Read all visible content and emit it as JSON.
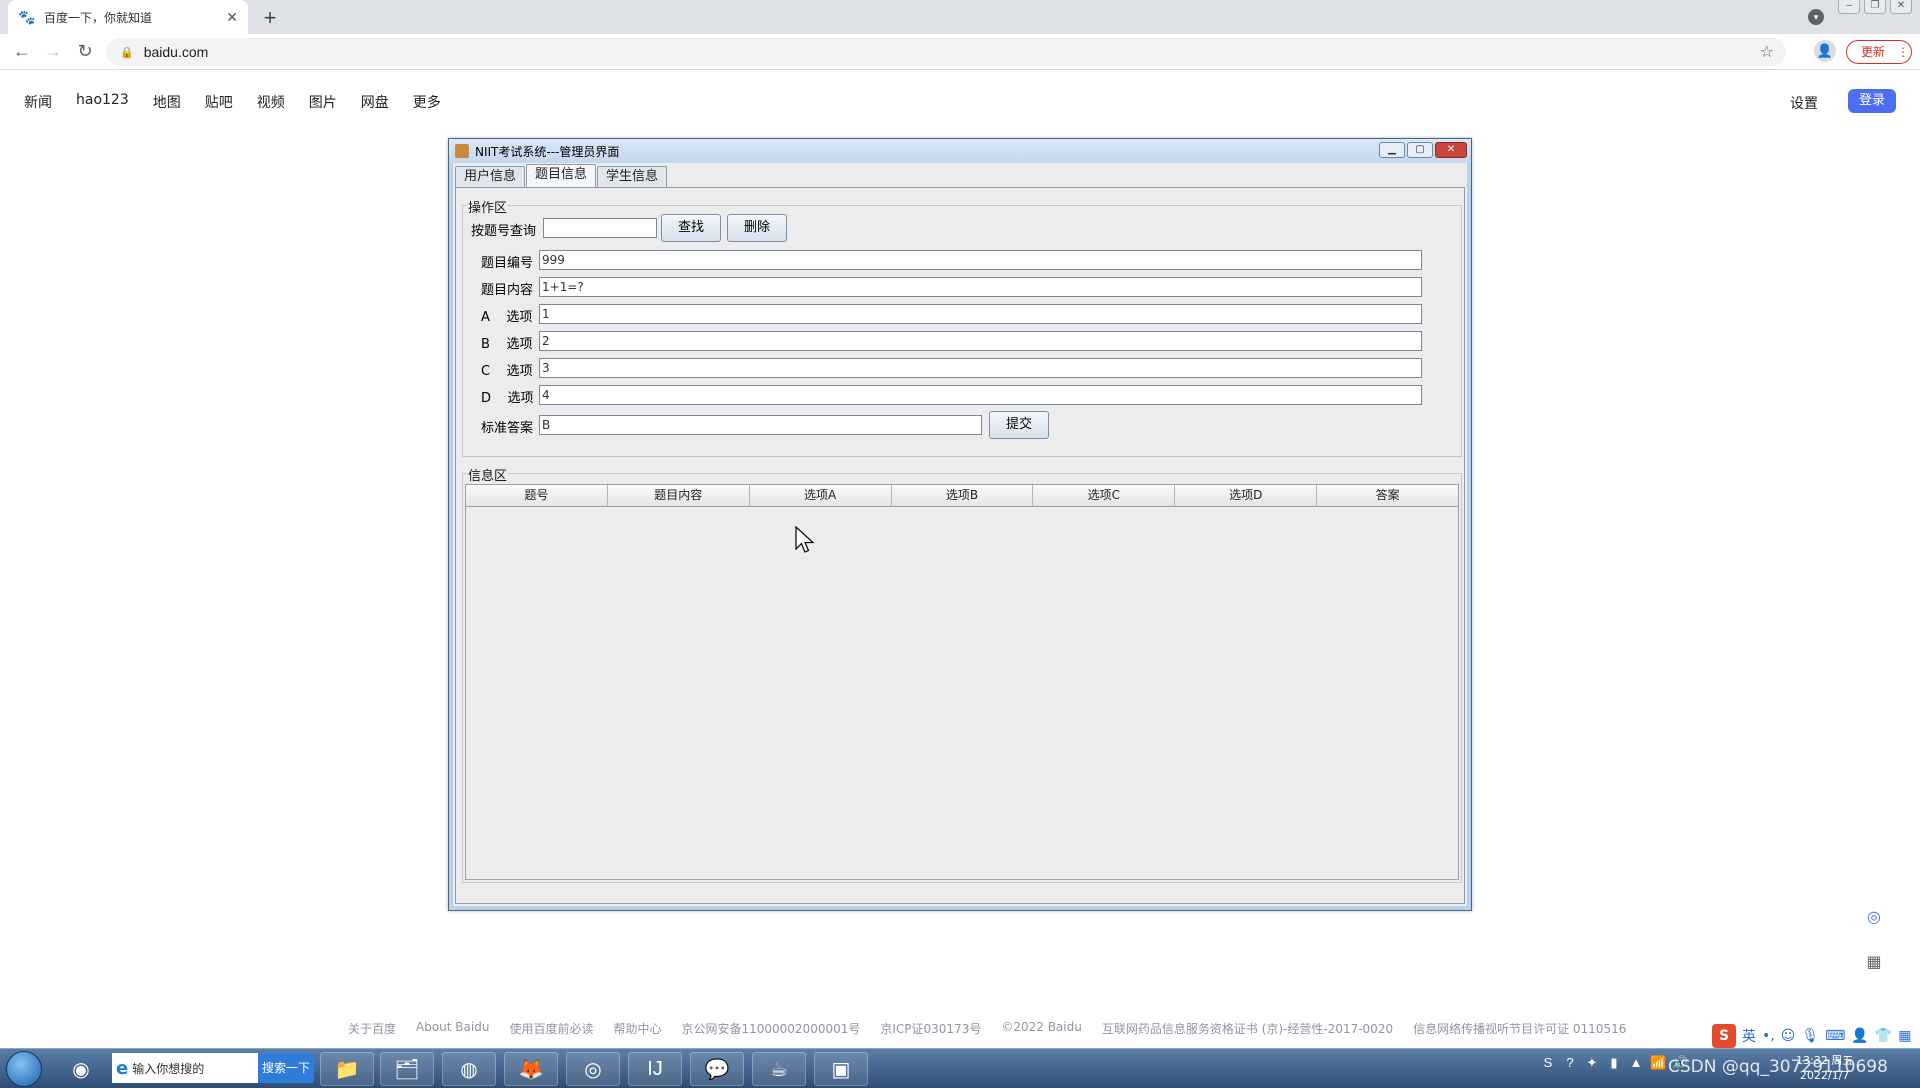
{
  "browser": {
    "tab_title": "百度一下，你就知道",
    "url": "baidu.com",
    "update_label": "更新"
  },
  "baidu": {
    "nav": [
      "新闻",
      "hao123",
      "地图",
      "贴吧",
      "视频",
      "图片",
      "网盘",
      "更多"
    ],
    "settings": "设置",
    "login": "登录",
    "footer": [
      "关于百度",
      "About Baidu",
      "使用百度前必读",
      "帮助中心",
      "京公网安备11000002000001号",
      "京ICP证030173号",
      "©2022 Baidu",
      "互联网药品信息服务资格证书 (京)-经营性-2017-0020",
      "信息网络传播视听节目许可证 0110516"
    ]
  },
  "app": {
    "title": "NIIT考试系统---管理员界面",
    "tabs": [
      "用户信息",
      "题目信息",
      "学生信息"
    ],
    "active_tab": 1,
    "ops_legend": "操作区",
    "search_label": "按题号查询",
    "search_value": "",
    "find_button": "查找",
    "delete_button": "删除",
    "fields": [
      {
        "label": "题目编号",
        "value": "999"
      },
      {
        "label": "题目内容",
        "value": "1+1=?"
      },
      {
        "label": "A    选项",
        "value": "1"
      },
      {
        "label": "B    选项",
        "value": "2"
      },
      {
        "label": "C    选项",
        "value": "3"
      },
      {
        "label": "D    选项",
        "value": "4"
      }
    ],
    "answer_label": "标准答案",
    "answer_value": "B",
    "submit_button": "提交",
    "info_legend": "信息区",
    "table_columns": [
      "题号",
      "题目内容",
      "选项A",
      "选项B",
      "选项C",
      "选项D",
      "答案"
    ]
  },
  "taskbar": {
    "search_placeholder": "输入你想搜的",
    "search_button": "搜索一下",
    "ime_lang": "英",
    "clock_time": "13:32 周五",
    "clock_date": "2022/1/7",
    "watermark": "CSDN @qq_30729110698"
  }
}
